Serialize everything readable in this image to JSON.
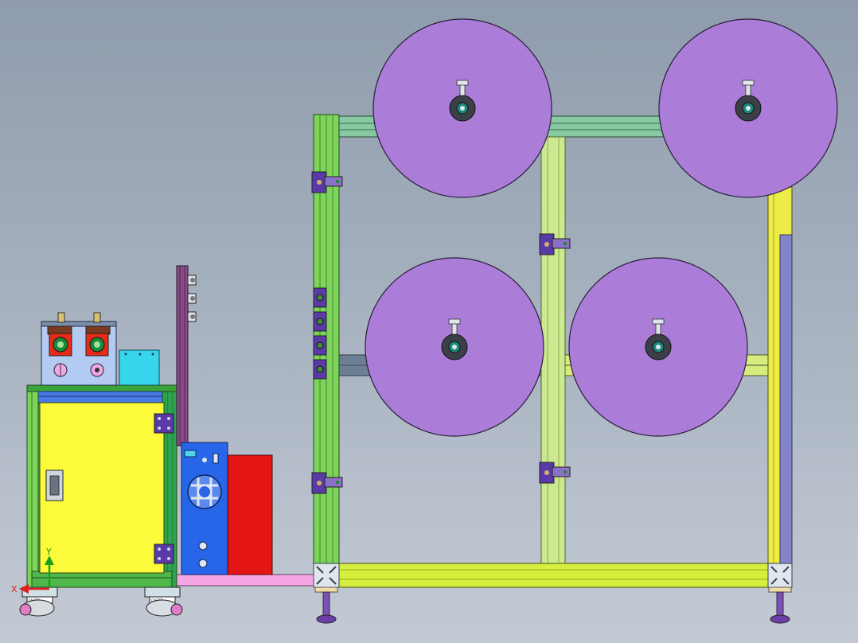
{
  "viewport": {
    "background_top": "#8f9cad",
    "background_bottom": "#c3cad4"
  },
  "colors": {
    "roll": "#ab7dd8",
    "frame_green": "#7ed35a",
    "frame_light": "#cde98f",
    "frame_teal": "#86c9a2",
    "cabinet_yellow": "#fbfb3c",
    "controller_blue": "#2766e8",
    "red_box": "#e51515",
    "cyan_box": "#38d6ec",
    "pink_rail": "#f6a6e4",
    "bracket": "#5a3aa8"
  },
  "rolls": [
    {
      "id": "roll-top-left"
    },
    {
      "id": "roll-top-right"
    },
    {
      "id": "roll-middle-left"
    },
    {
      "id": "roll-middle-right"
    }
  ],
  "triad": {
    "x_label": "X",
    "y_label": "Y"
  },
  "icons": {
    "triad": "coordinate-triad-icon",
    "leveling_foot": "leveling-foot-icon",
    "caster": "caster-wheel-icon"
  }
}
